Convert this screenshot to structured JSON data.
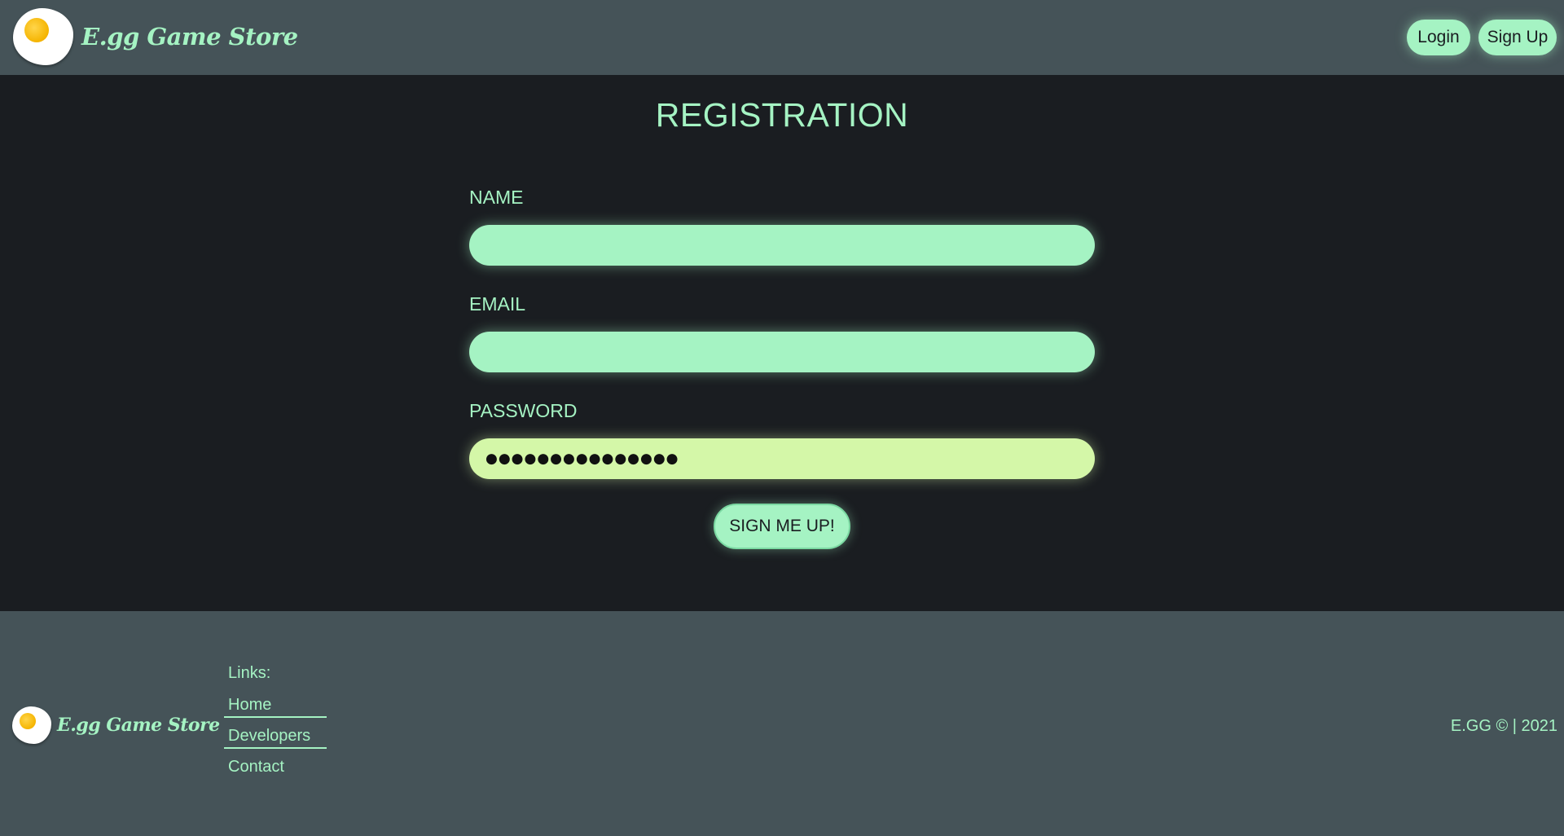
{
  "header": {
    "brand_name": "E.gg Game Store",
    "login_label": "Login",
    "signup_label": "Sign Up"
  },
  "form": {
    "title": "REGISTRATION",
    "name_label": "NAME",
    "name_value": "",
    "email_label": "EMAIL",
    "email_value": "",
    "password_label": "PASSWORD",
    "password_value": "●●●●●●●●●●●●●●●",
    "submit_label": "SIGN ME UP!"
  },
  "footer": {
    "brand_name": "E.gg Game Store",
    "links_title": "Links:",
    "links": [
      {
        "label": "Home"
      },
      {
        "label": "Developers"
      },
      {
        "label": "Contact"
      }
    ],
    "copyright": "E.GG © | 2021"
  },
  "colors": {
    "accent": "#a5f3c3",
    "password_field": "#d4f7a8",
    "header_bg": "#455358",
    "body_bg": "#1a1d21"
  }
}
